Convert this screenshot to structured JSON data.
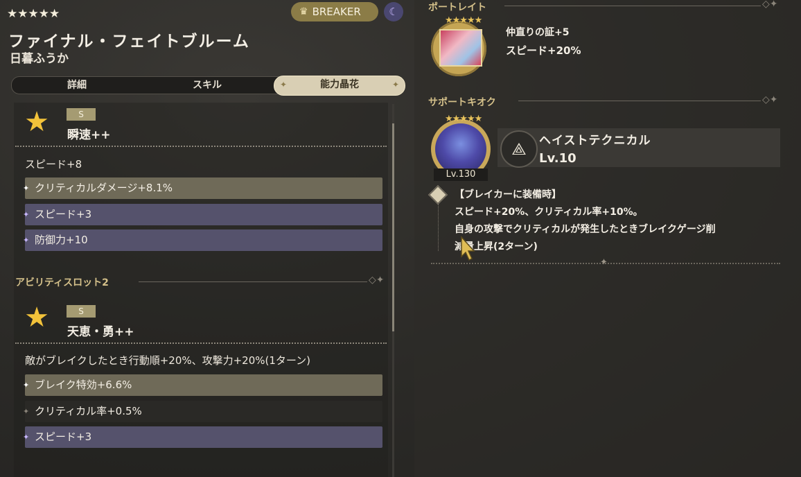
{
  "header": {
    "stars": "★★★★★",
    "role_label": "BREAKER",
    "title": "ファイナル・フェイトブルーム",
    "character": "日暮ふうか"
  },
  "tabs": [
    {
      "label": "詳細"
    },
    {
      "label": "スキル"
    },
    {
      "label": "能力晶花"
    }
  ],
  "slot1": {
    "rank": "S",
    "name": "瞬速++",
    "main_stat": "スピード+8",
    "subs": [
      "クリティカルダメージ+8.1%",
      "スピード+3",
      "防御力+10"
    ]
  },
  "slot2": {
    "section_label": "アビリティスロット2",
    "rank": "S",
    "name": "天恵・勇++",
    "main_stat": "敵がブレイクしたとき行動順+20%、攻撃力+20%(1ターン)",
    "subs": [
      "ブレイク特効+6.6%",
      "クリティカル率+0.5%",
      "スピード+3"
    ]
  },
  "portrait": {
    "section_label": "ポートレイト",
    "line1": "仲直りの証+5",
    "line2": "スピード+20%"
  },
  "support": {
    "section_label": "サポートキオク",
    "level_badge": "Lv.130",
    "name": "ヘイストテクニカル",
    "level": "Lv.10",
    "effect_title": "【ブレイカーに装備時】",
    "effect_line1": "スピード+20%、クリティカル率+10%。",
    "effect_line2": "自身の攻撃でクリティカルが発生したときブレイクゲージ削",
    "effect_line3": "減量上昇(2ターン)"
  },
  "colors": {
    "accent_gold": "#8b7c47",
    "row_gold": "#6f6a58",
    "row_purple": "#55526c",
    "star_yellow": "#f2c23a"
  }
}
